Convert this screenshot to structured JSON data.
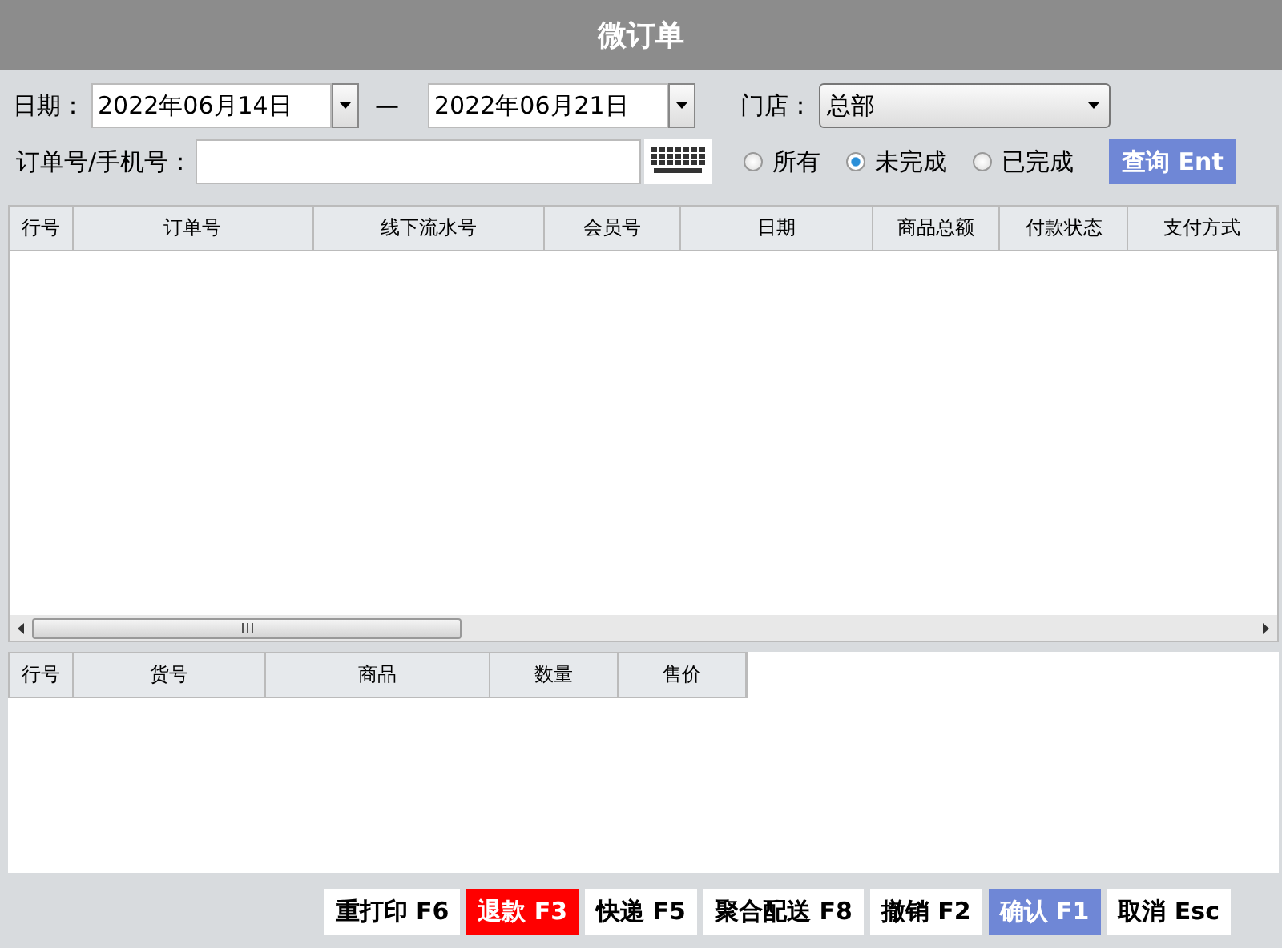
{
  "window": {
    "title": "微订单"
  },
  "filters": {
    "date_label": "日期：",
    "date_from": "2022年06月14日",
    "date_sep": "—",
    "date_to": "2022年06月21日",
    "store_label": "门店：",
    "store": "总部",
    "order_label": "订单号/手机号：",
    "status_options": [
      {
        "label": "所有",
        "selected": false
      },
      {
        "label": "未完成",
        "selected": true
      },
      {
        "label": "已完成",
        "selected": false
      }
    ],
    "query_button": "查询 Ent"
  },
  "orders_table": {
    "columns": [
      "行号",
      "订单号",
      "线下流水号",
      "会员号",
      "日期",
      "商品总额",
      "付款状态",
      "支付方式"
    ]
  },
  "items_table": {
    "columns": [
      "行号",
      "货号",
      "商品",
      "数量",
      "售价"
    ]
  },
  "buttons": [
    {
      "label": "重打印 F6",
      "kind": "default"
    },
    {
      "label": "退款 F3",
      "kind": "danger"
    },
    {
      "label": "快递 F5",
      "kind": "default"
    },
    {
      "label": "聚合配送 F8",
      "kind": "default"
    },
    {
      "label": "撤销 F2",
      "kind": "default"
    },
    {
      "label": "确认 F1",
      "kind": "primary"
    },
    {
      "label": "取消 Esc",
      "kind": "default"
    }
  ]
}
